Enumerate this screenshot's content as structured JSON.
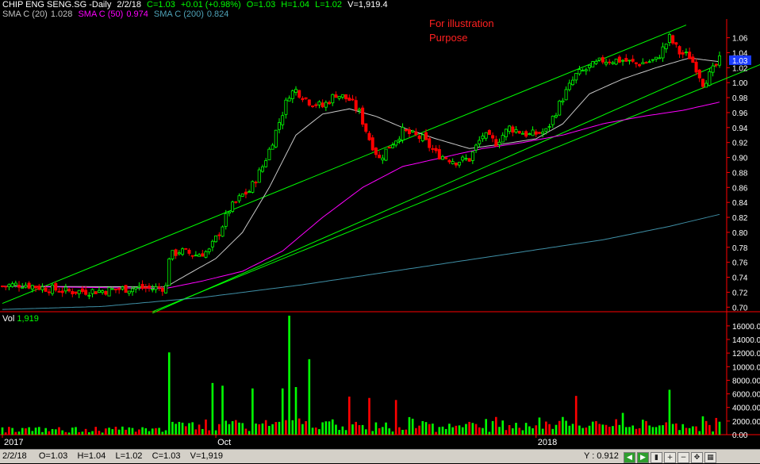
{
  "header": {
    "symbol": "CHIP ENG SENG.SG -Daily",
    "date": "2/2/18",
    "close_change_label": "C=1.03",
    "change": "+0.01 (+0.98%)",
    "open": "O=1.03",
    "high": "H=1.04",
    "low": "L=1.02",
    "volume": "V=1,919.4",
    "ma20_label": "SMA C (20)",
    "ma20_value": "1.028",
    "ma50_label": "SMA C (50)",
    "ma50_value": "0.974",
    "ma200_label": "SMA C (200)",
    "ma200_value": "0.824"
  },
  "annotation": "For illustration Purpose",
  "volume_panel": {
    "label": "Vol",
    "value": "1,919"
  },
  "status_bar": {
    "info": "2/2/18     O=1.03    H=1.04    L=1.02    C=1.03    V=1,919",
    "y_readout": "Y : 0.912",
    "buttons": [
      "scroll-left",
      "scroll-right",
      "chart-type",
      "zoom-in",
      "zoom-out",
      "pan",
      "grid"
    ]
  },
  "colors": {
    "background": "#000000",
    "up": "#00ff00",
    "down": "#ff0000",
    "ma20": "#c8c8c8",
    "ma50": "#ff00ff",
    "ma200": "#3f8fa6",
    "trendline": "#00ff00",
    "axis": "#ff0000",
    "last_price_tag": "#1a3cff"
  },
  "chart_data": [
    {
      "type": "candlestick",
      "title": "CHIP ENG SENG.SG -Daily",
      "x_tick_labels": [
        "2017",
        "Oct",
        "2018"
      ],
      "yticks": [
        0.7,
        0.72,
        0.74,
        0.76,
        0.78,
        0.8,
        0.82,
        0.84,
        0.86,
        0.88,
        0.9,
        0.92,
        0.94,
        0.96,
        0.98,
        1.0,
        1.02,
        1.04,
        1.06
      ],
      "ylim": [
        0.695,
        1.085
      ],
      "last_price": 1.03,
      "price_anchors": [
        [
          0,
          0.728
        ],
        [
          6,
          0.731
        ],
        [
          12,
          0.726
        ],
        [
          20,
          0.721
        ],
        [
          30,
          0.722
        ],
        [
          40,
          0.726
        ],
        [
          45,
          0.725
        ],
        [
          49,
          0.727
        ],
        [
          50,
          0.768
        ],
        [
          53,
          0.775
        ],
        [
          58,
          0.77
        ],
        [
          62,
          0.775
        ],
        [
          65,
          0.8
        ],
        [
          68,
          0.83
        ],
        [
          72,
          0.85
        ],
        [
          74,
          0.855
        ],
        [
          78,
          0.888
        ],
        [
          80,
          0.91
        ],
        [
          84,
          0.96
        ],
        [
          86,
          0.985
        ],
        [
          88,
          0.99
        ],
        [
          92,
          0.975
        ],
        [
          96,
          0.968
        ],
        [
          100,
          0.985
        ],
        [
          104,
          0.977
        ],
        [
          107,
          0.96
        ],
        [
          110,
          0.925
        ],
        [
          113,
          0.898
        ],
        [
          116,
          0.915
        ],
        [
          120,
          0.935
        ],
        [
          126,
          0.925
        ],
        [
          130,
          0.905
        ],
        [
          136,
          0.895
        ],
        [
          140,
          0.898
        ],
        [
          144,
          0.93
        ],
        [
          148,
          0.92
        ],
        [
          152,
          0.94
        ],
        [
          158,
          0.93
        ],
        [
          163,
          0.935
        ],
        [
          168,
          0.98
        ],
        [
          172,
          1.01
        ],
        [
          176,
          1.02
        ],
        [
          180,
          1.03
        ],
        [
          186,
          1.03
        ],
        [
          190,
          1.025
        ],
        [
          196,
          1.03
        ],
        [
          200,
          1.06
        ],
        [
          203,
          1.04
        ],
        [
          206,
          1.035
        ],
        [
          208,
          1.02
        ],
        [
          210,
          1.0
        ],
        [
          212,
          1.01
        ],
        [
          215,
          1.03
        ]
      ],
      "moving_averages": [
        {
          "name": "SMA C (20)",
          "anchors": [
            [
              0,
              0.728
            ],
            [
              49,
              0.727
            ],
            [
              56,
              0.745
            ],
            [
              64,
              0.765
            ],
            [
              72,
              0.8
            ],
            [
              80,
              0.86
            ],
            [
              88,
              0.93
            ],
            [
              96,
              0.958
            ],
            [
              104,
              0.965
            ],
            [
              112,
              0.955
            ],
            [
              120,
              0.94
            ],
            [
              130,
              0.925
            ],
            [
              140,
              0.912
            ],
            [
              150,
              0.918
            ],
            [
              160,
              0.925
            ],
            [
              168,
              0.945
            ],
            [
              176,
              0.985
            ],
            [
              186,
              1.005
            ],
            [
              196,
              1.02
            ],
            [
              206,
              1.033
            ],
            [
              215,
              1.028
            ]
          ]
        },
        {
          "name": "SMA C (50)",
          "anchors": [
            [
              0,
              0.728
            ],
            [
              49,
              0.725
            ],
            [
              60,
              0.735
            ],
            [
              72,
              0.748
            ],
            [
              84,
              0.775
            ],
            [
              96,
              0.82
            ],
            [
              108,
              0.86
            ],
            [
              120,
              0.888
            ],
            [
              132,
              0.9
            ],
            [
              144,
              0.912
            ],
            [
              156,
              0.92
            ],
            [
              168,
              0.93
            ],
            [
              180,
              0.945
            ],
            [
              192,
              0.955
            ],
            [
              204,
              0.963
            ],
            [
              215,
              0.974
            ]
          ]
        },
        {
          "name": "SMA C (200)",
          "anchors": [
            [
              0,
              0.697
            ],
            [
              30,
              0.701
            ],
            [
              60,
              0.713
            ],
            [
              90,
              0.73
            ],
            [
              120,
              0.75
            ],
            [
              150,
              0.77
            ],
            [
              180,
              0.79
            ],
            [
              200,
              0.808
            ],
            [
              215,
              0.824
            ]
          ]
        }
      ],
      "trendlines": [
        {
          "name": "upper-channel",
          "from": [
            0,
            0.705
          ],
          "to": [
            205,
            1.077
          ]
        },
        {
          "name": "lower-channel",
          "from": [
            45,
            0.694
          ],
          "to": [
            258,
            1.08
          ]
        },
        {
          "name": "upper-support",
          "from": [
            45,
            0.692
          ],
          "to": [
            215,
            1.025
          ]
        }
      ]
    },
    {
      "type": "bar",
      "title": "Vol",
      "yticks": [
        0,
        2000,
        4000,
        6000,
        8000,
        10000,
        12000,
        14000,
        16000
      ],
      "ylim": [
        0,
        17500
      ],
      "last_value": 1919,
      "peaks": [
        [
          50,
          12100
        ],
        [
          63,
          7600
        ],
        [
          66,
          7200
        ],
        [
          75,
          6800
        ],
        [
          84,
          6800
        ],
        [
          86,
          17500
        ],
        [
          88,
          7000
        ],
        [
          92,
          11100
        ],
        [
          104,
          5600
        ],
        [
          110,
          5400
        ],
        [
          118,
          5100
        ],
        [
          148,
          2600
        ],
        [
          168,
          2600
        ],
        [
          172,
          5700
        ],
        [
          186,
          3200
        ],
        [
          200,
          6600
        ],
        [
          210,
          2700
        ],
        [
          215,
          1900
        ]
      ]
    }
  ]
}
